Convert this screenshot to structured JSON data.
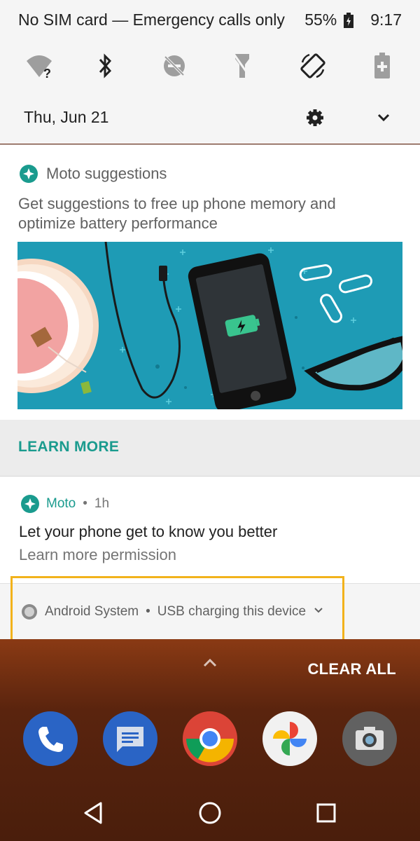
{
  "status_bar": {
    "carrier_text": "No SIM card — Emergency calls only",
    "battery_percent": "55%",
    "time": "9:17"
  },
  "quick_settings": {
    "icons": [
      "wifi-unknown-icon",
      "bluetooth-icon",
      "do-not-disturb-off-icon",
      "flashlight-off-icon",
      "auto-rotate-icon",
      "battery-saver-icon"
    ],
    "date": "Thu, Jun 21"
  },
  "notifications": {
    "moto_suggestions": {
      "app_name": "Moto suggestions",
      "body": "Get suggestions to free up phone memory and optimize battery performance",
      "action": "LEARN MORE"
    },
    "moto": {
      "app_name": "Moto",
      "separator": "•",
      "time_ago": "1h",
      "title": "Let your phone get to know you better",
      "subtitle": "Learn more permission"
    },
    "android_system": {
      "app_name": "Android System",
      "separator": "•",
      "text": "USB charging this device"
    },
    "clear_all": "CLEAR ALL"
  },
  "dock": {
    "apps": [
      "phone-app-icon",
      "messages-app-icon",
      "chrome-app-icon",
      "photos-app-icon",
      "camera-app-icon"
    ]
  },
  "nav": {
    "buttons": [
      "back-button",
      "home-button",
      "recents-button"
    ]
  },
  "colors": {
    "accent_teal": "#1a9b8e",
    "highlight_yellow": "#f2b21b",
    "illustration_bg": "#1e9bb5"
  }
}
